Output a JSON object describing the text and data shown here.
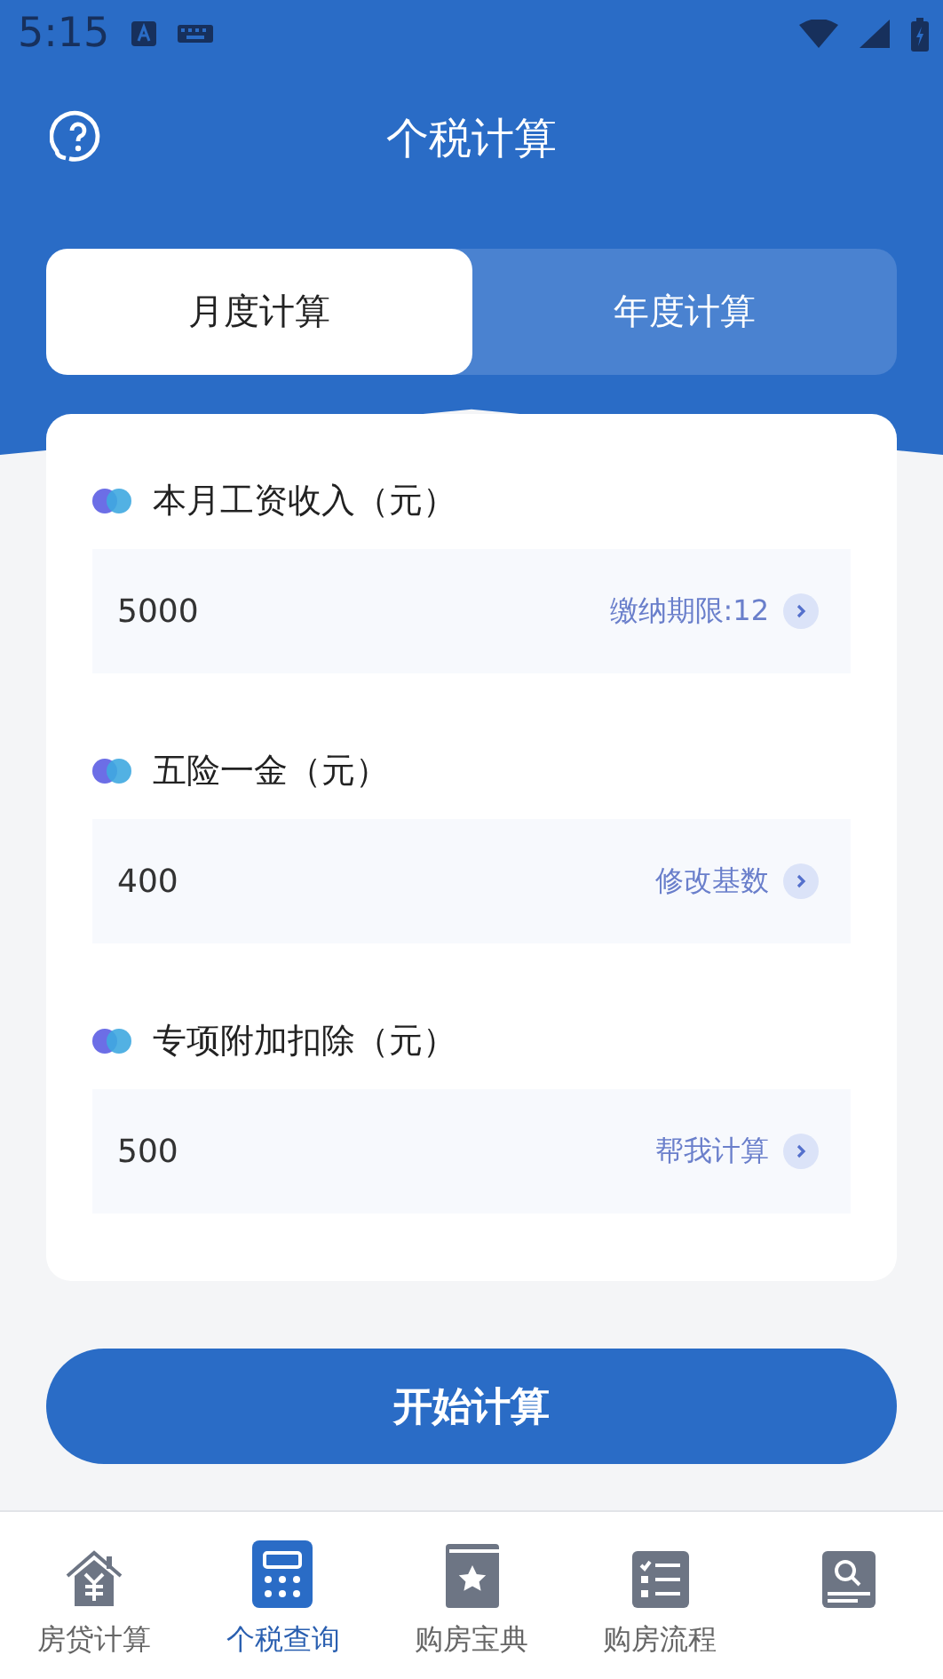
{
  "status_bar": {
    "time": "5:15"
  },
  "header": {
    "title": "个税计算"
  },
  "tabs": [
    {
      "label": "月度计算",
      "selected": true
    },
    {
      "label": "年度计算",
      "selected": false
    }
  ],
  "fields": [
    {
      "label": "本月工资收入（元）",
      "value": "5000",
      "action": "缴纳期限:12"
    },
    {
      "label": "五险一金（元）",
      "value": "400",
      "action": "修改基数"
    },
    {
      "label": "专项附加扣除（元）",
      "value": "500",
      "action": "帮我计算"
    }
  ],
  "submit_button": {
    "label": "开始计算"
  },
  "bottom_nav": [
    {
      "kind": "house",
      "label": "房贷计算",
      "selected": false
    },
    {
      "kind": "calculator",
      "label": "个税查询",
      "selected": true
    },
    {
      "kind": "book",
      "label": "购房宝典",
      "selected": false
    },
    {
      "kind": "checklist",
      "label": "购房流程",
      "selected": false
    },
    {
      "kind": "search-doc",
      "selected": false
    }
  ]
}
